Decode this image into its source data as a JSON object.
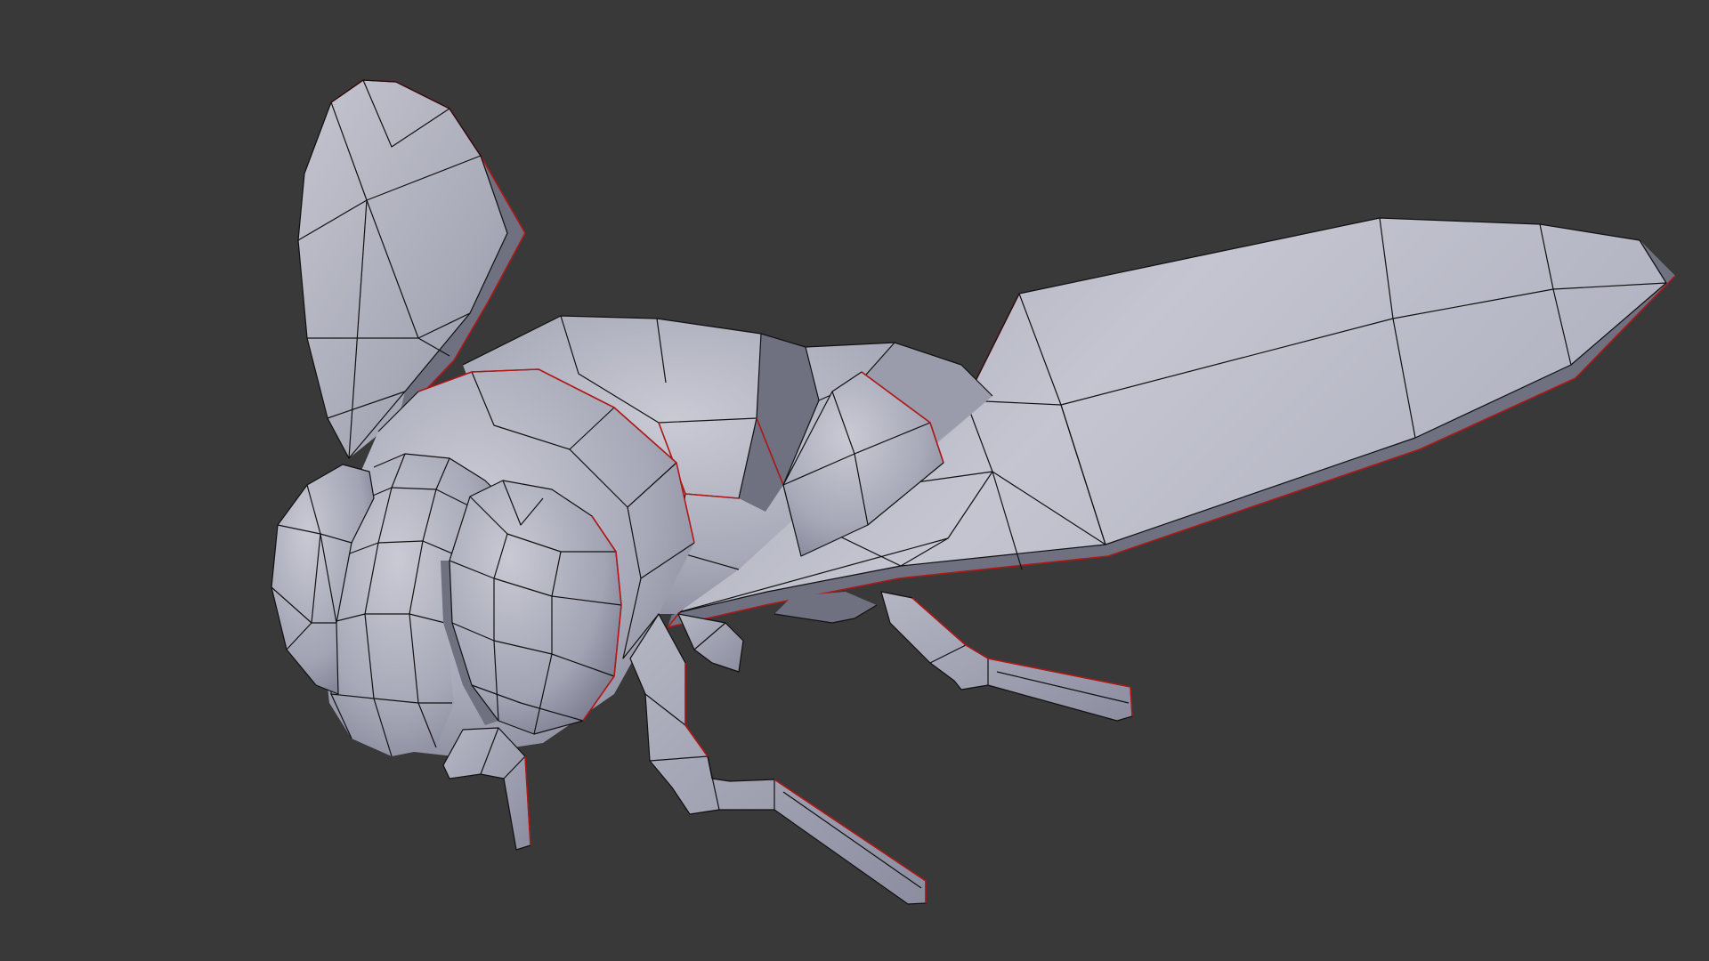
{
  "viewport": {
    "background": "#393939",
    "mesh_color": "#b6b7c4",
    "edge_color": "#111111",
    "seam_color": "#b01818"
  },
  "model": {
    "parts": [
      "wing-left",
      "wing-right",
      "thorax",
      "head",
      "eye-left",
      "eye-right",
      "antenna",
      "front-leg",
      "middle-leg",
      "hind-leg"
    ]
  }
}
